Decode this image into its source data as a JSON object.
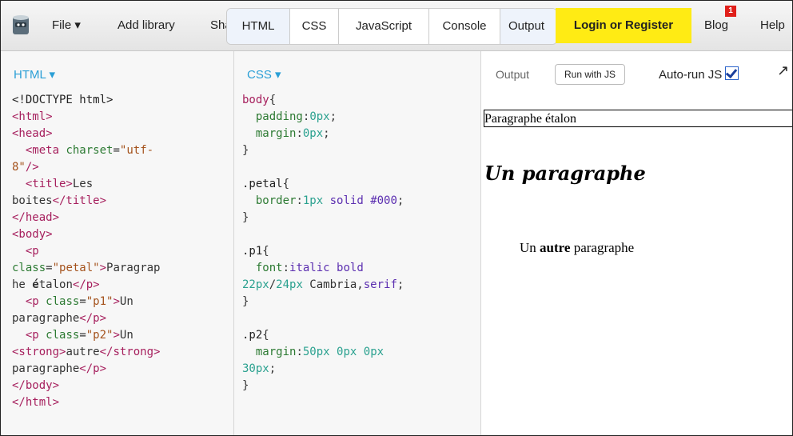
{
  "toolbar": {
    "file_label": "File ▾",
    "add_library": "Add library",
    "share": "Share",
    "tabs": [
      "HTML",
      "CSS",
      "JavaScript",
      "Console",
      "Output"
    ],
    "login": "Login or Register",
    "blog": "Blog",
    "blog_badge": "1",
    "help": "Help"
  },
  "html_pane": {
    "title": "HTML ▾"
  },
  "css_pane": {
    "title": "CSS ▾"
  },
  "output_pane": {
    "label": "Output",
    "run_button": "Run with JS",
    "autorun_label": "Auto-run JS",
    "autorun_checked": true,
    "paragraph_petal": "Paragraphe étalon",
    "paragraph_p1": "Un paragraphe",
    "paragraph_p2_before": "Un ",
    "paragraph_p2_strong": "autre",
    "paragraph_p2_after": " paragraphe"
  },
  "colors": {
    "accent": "#2a9fd6",
    "login_bg": "#ffeb14",
    "badge": "#e0201b"
  }
}
